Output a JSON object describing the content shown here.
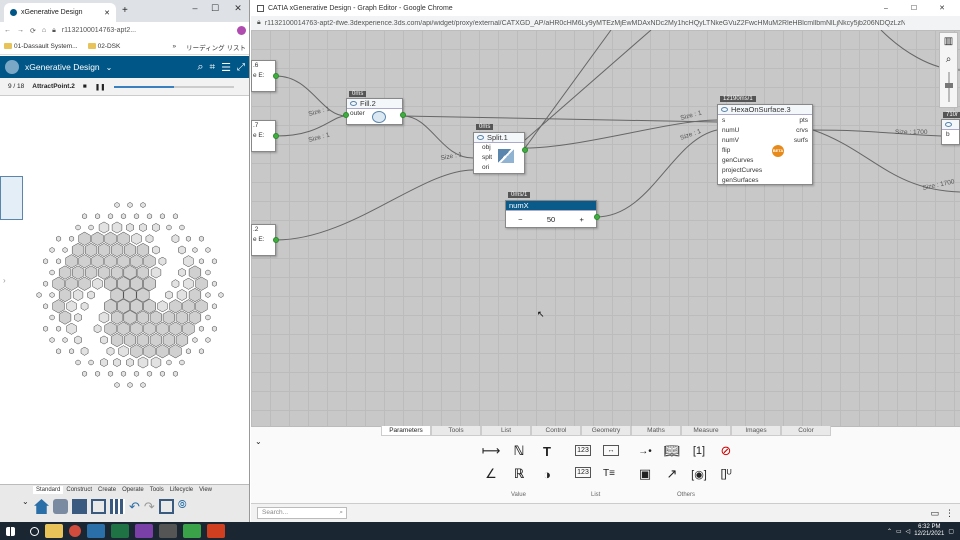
{
  "left": {
    "tab_title": "xGenerative Design",
    "address": "r1132100014763-apt2...",
    "bookmarks": [
      "01-Dassault System...",
      "02-DSK",
      "»",
      "リーディング リスト"
    ],
    "app_title": "xGenerative Design",
    "counter": "9 / 18",
    "point_label": "AttractPoint.2",
    "bottom_tabs": [
      "Standard",
      "Construct",
      "Create",
      "Operate",
      "Tools",
      "Lifecycle",
      "View"
    ]
  },
  "right": {
    "window_title": "CATIA xGenerative Design - Graph Editor - Google Chrome",
    "address": "r1132100014763-apt2-ifwe.3dexperience.3ds.com/api/widget/proxy/external/CATXGD_AP/aHR0cHM6Ly9yMTEzMjEwMDAxNDc2My1hcHQyLTNkeGVuZ2FwcHMuM2RleHBlcmllbmNlLjNkcy5jb206NDQzLzNEWEVuZ2luZ...",
    "nodes": {
      "fill": {
        "badge": "0ms",
        "title": "Fill.2",
        "port": "outer"
      },
      "split": {
        "badge": "0ms",
        "title": "Split.1",
        "ports": [
          "obj",
          "splt",
          "ori"
        ]
      },
      "numx": {
        "badge": "0ms/1",
        "title": "numX",
        "minus": "−",
        "value": "50",
        "plus": "+"
      },
      "hexa": {
        "badge": "12190ms/1",
        "title": "HexaOnSurface.3",
        "inputs": [
          "s",
          "numU",
          "numV",
          "flip",
          "genCurves",
          "projectCurves",
          "genSurfaces"
        ],
        "outputs": [
          "pts",
          "crvs",
          "surfs"
        ],
        "beta": "BETA"
      },
      "far": {
        "badge": "710r",
        "port": "b"
      },
      "left_frag": [
        ".6",
        "e E:",
        ".7",
        "e E:",
        ".2",
        "e E:"
      ]
    },
    "wire_labels": [
      "Size : 1",
      "Size : 1",
      "Size : 1",
      "Size : 1",
      "Size : 1",
      "Size : 1700",
      "Size : 1700"
    ],
    "panel_tabs": [
      "Parameters",
      "Tools",
      "List",
      "Control",
      "Geometry",
      "Maths",
      "Measure",
      "Images",
      "Color"
    ],
    "group_labels": [
      "Value",
      "List",
      "Others"
    ],
    "search_placeholder": "Search..."
  },
  "taskbar": {
    "time": "6:32 PM",
    "date": "12/21/2021"
  },
  "colors": {
    "header_blue": "#005686",
    "port_green": "#3fae3f",
    "node_dark": "#0a5a8a"
  }
}
